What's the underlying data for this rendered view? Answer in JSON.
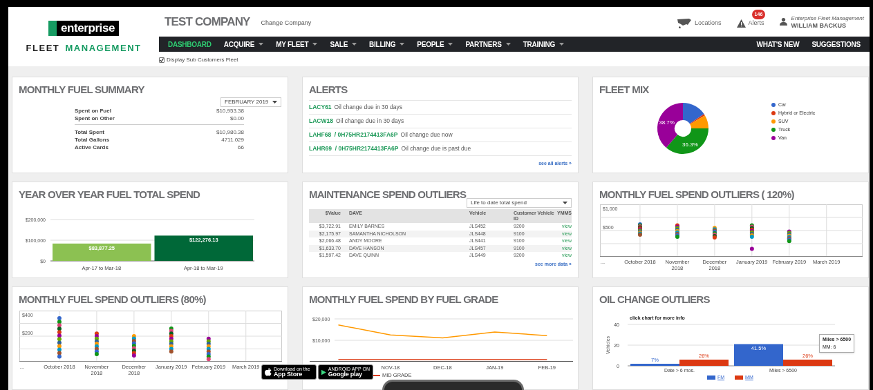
{
  "logo": {
    "brand": "enterprise",
    "word_1": "FLEET",
    "word_2": "MANAGEMENT"
  },
  "company": {
    "name": "TEST COMPANY",
    "change_link": "Change Company"
  },
  "top_links": [
    {
      "kind": "map",
      "label": "Locations"
    },
    {
      "kind": "alert",
      "label": "Alerts",
      "badge": "146"
    }
  ],
  "user": {
    "org": "Enterprise Fleet Management",
    "name": "WILLIAM BACKUS"
  },
  "nav": {
    "items": [
      {
        "label": "DASHBOARD",
        "selected": true,
        "dropdown": false
      },
      {
        "label": "ACQUIRE",
        "selected": false,
        "dropdown": true
      },
      {
        "label": "MY FLEET",
        "selected": false,
        "dropdown": true
      },
      {
        "label": "SALE",
        "selected": false,
        "dropdown": true
      },
      {
        "label": "BILLING",
        "selected": false,
        "dropdown": true
      },
      {
        "label": "PEOPLE",
        "selected": false,
        "dropdown": true
      },
      {
        "label": "PARTNERS",
        "selected": false,
        "dropdown": true
      },
      {
        "label": "TRAINING",
        "selected": false,
        "dropdown": true
      }
    ],
    "right_items": [
      "WHAT'S NEW",
      "SUGGESTIONS"
    ]
  },
  "sub_customers": {
    "label": "Display Sub Customers Fleet",
    "checked": true
  },
  "fuel_summary": {
    "title": "MONTHLY FUEL SUMMARY",
    "month_select": "FEBRUARY 2019",
    "groups": [
      [
        {
          "label": "Spent on Fuel",
          "value": "$10,953.38"
        },
        {
          "label": "Spent on Other",
          "value": "$0.00"
        }
      ],
      [
        {
          "label": "Total Spent",
          "value": "$10,980.38"
        },
        {
          "label": "Total Gallons",
          "value": "4711.029"
        },
        {
          "label": "Active Cards",
          "value": "66"
        }
      ]
    ]
  },
  "alerts": {
    "title": "ALERTS",
    "items": [
      {
        "unit": "LACY61",
        "message": "Oil change due in 30 days"
      },
      {
        "unit": "LACW18",
        "message": "Oil change due in 30 days"
      },
      {
        "unit": "LAHF68  / 0H75HR2174413FA6P",
        "message": "Oil change due now"
      },
      {
        "unit": "LAHR69  / 0H75HR2174413FA6P",
        "message": "Oil change due is past due"
      }
    ],
    "more": "see all alerts »"
  },
  "fleet_mix": {
    "title": "FLEET MIX",
    "chart_data": {
      "type": "donut",
      "categories": [
        "Car",
        "Hybrid or Electric",
        "SUV",
        "Truck",
        "Van"
      ],
      "values": [
        15.5,
        1,
        8.5,
        36.3,
        38.7
      ],
      "colors": [
        "#3366cc",
        "#dc3912",
        "#ff9900",
        "#109618",
        "#990099"
      ],
      "value_labels": [
        null,
        null,
        null,
        "36.3%",
        "38.7%"
      ]
    }
  },
  "yoy": {
    "title": "YEAR OVER YEAR FUEL TOTAL SPEND",
    "chart_data": {
      "type": "bar",
      "categories": [
        "Apr-17 to Mar-18",
        "Apr-18 to Mar-19"
      ],
      "stacked": true,
      "series": [
        {
          "color": "#8cc152",
          "values": [
            83877.25,
            null
          ]
        },
        {
          "color": "#006838",
          "values": [
            null,
            122276.13
          ]
        }
      ],
      "ylim": [
        0,
        200000
      ],
      "yticks": [
        {
          "value": 0,
          "label": "$0"
        },
        {
          "value": 100000,
          "label": "$100,000"
        },
        {
          "value": 200000,
          "label": "$200,000"
        }
      ],
      "value_labels": [
        "$83,877.25",
        "$122,276.13"
      ]
    }
  },
  "maintenance": {
    "title": "MAINTENANCE SPEND OUTLIERS",
    "select": "Life to date total spend",
    "columns": [
      "$Value",
      "DAVE",
      "Vehicle",
      "Customer Vehicle ID",
      "YMMS"
    ],
    "rows": [
      [
        "$3,722.91",
        "EMILY BARNES",
        "JLS452",
        "9200",
        "view"
      ],
      [
        "$2,175.97",
        "SAMANTHA NICHOLSON",
        "JLS448",
        "9100",
        "view"
      ],
      [
        "$2,066.48",
        "ANDY MOORE",
        "JLS441",
        "9100",
        "view"
      ],
      [
        "$1,633.70",
        "DAVE HANSON",
        "JLS457",
        "9100",
        "view"
      ],
      [
        "$1,597.42",
        "DAVE QUINN",
        "JLS449",
        "9200",
        "view"
      ]
    ],
    "more": "see more data »"
  },
  "outliers_120": {
    "title": "MONTHLY FUEL SPEND OUTLIERS ( 120%)",
    "y_labels": [
      "$1,000",
      "$500"
    ],
    "x_labels": [
      "...",
      "October 2018",
      "November 2018",
      "December 2018",
      "January 2019",
      "February 2019",
      "March 2019"
    ]
  },
  "outliers_80": {
    "title": "MONTHLY FUEL SPEND OUTLIERS (80%)",
    "y_labels": [
      "$400",
      "$200"
    ],
    "x_labels": [
      "...",
      "October 2018",
      "November 2018",
      "December 2018",
      "January 2019",
      "February 2019",
      "March 2019"
    ]
  },
  "fuel_grade": {
    "title": "MONTHLY FUEL SPEND BY FUEL GRADE",
    "chart_data": {
      "type": "line",
      "categories": [
        null,
        "NOV-18",
        "DEC-18",
        "JAN-19",
        "FEB-19"
      ],
      "ylim": [
        0,
        20000
      ],
      "yticks": [
        {
          "value": 10000,
          "label": "$10,000"
        },
        {
          "value": 20000,
          "label": "$20,000"
        }
      ],
      "series": [
        {
          "color": "#ff9900",
          "values": [
            17200,
            12500,
            11100,
            13900,
            12200
          ]
        },
        {
          "name": "MID GRADE",
          "color": "#dc3912",
          "values": [
            1000,
            1000,
            1000,
            1000,
            1000
          ]
        }
      ]
    }
  },
  "oil_change": {
    "title": "OIL CHANGE OUTLIERS",
    "chart_data": {
      "type": "bar",
      "title": "click chart for more info",
      "ylabel": "Vehicles",
      "categories": [
        "Date > 6 mos.",
        "Miles > 6500"
      ],
      "ylim": [
        0,
        40
      ],
      "yticks": [
        0,
        20,
        40
      ],
      "series": [
        {
          "name": "FM",
          "color": "#3366cc",
          "values": [
            2,
            21
          ]
        },
        {
          "name": "MM",
          "color": "#dc3912",
          "values": [
            6,
            6
          ]
        }
      ],
      "value_labels": [
        [
          "7%",
          "41.5%"
        ],
        [
          "26%",
          "26%"
        ]
      ],
      "legend": "bottom"
    },
    "tooltip": {
      "title": "Miles > 6500",
      "text": "MM: 6"
    }
  },
  "app_badges": [
    {
      "kind": "apple",
      "small": "Download on the",
      "big": "App Store"
    },
    {
      "kind": "google",
      "small": "ANDROID APP ON",
      "big": "Google play"
    }
  ]
}
